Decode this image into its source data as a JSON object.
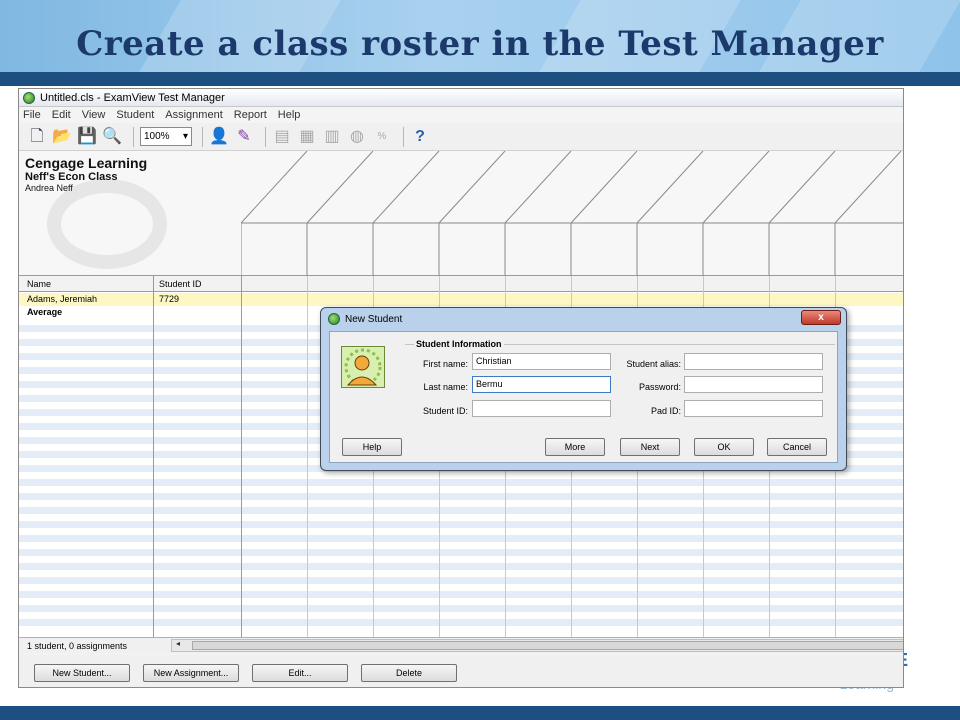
{
  "slide": {
    "title": "Create a class roster in the Test Manager",
    "brand_fragment": "E",
    "brand_fragment2": "Learning"
  },
  "window": {
    "title": "Untitled.cls - ExamView Test Manager",
    "menu": [
      "File",
      "Edit",
      "View",
      "Student",
      "Assignment",
      "Report",
      "Help"
    ],
    "zoom": "100%"
  },
  "class_info": {
    "organization": "Cengage Learning",
    "class_name": "Neff's Econ Class",
    "teacher": "Andrea Neff"
  },
  "grid": {
    "columns": [
      "Name",
      "Student ID"
    ],
    "rows": [
      {
        "name": "Adams, Jeremiah",
        "student_id": "7729"
      }
    ],
    "average_label": "Average"
  },
  "status": {
    "text": "1 student, 0 assignments"
  },
  "bottom_buttons": {
    "new_student": "New Student...",
    "new_assignment": "New Assignment...",
    "edit": "Edit...",
    "delete": "Delete"
  },
  "dialog": {
    "title": "New Student",
    "close": "x",
    "group_label": "Student Information",
    "first_name_label": "First name:",
    "first_name_value": "Christian",
    "last_name_label": "Last name:",
    "last_name_value": "Bermu",
    "student_id_label": "Student ID:",
    "student_id_value": "",
    "alias_label": "Student alias:",
    "alias_value": "",
    "password_label": "Password:",
    "password_value": "",
    "pad_id_label": "Pad ID:",
    "pad_id_value": "",
    "buttons": {
      "help": "Help",
      "more": "More",
      "next": "Next",
      "ok": "OK",
      "cancel": "Cancel"
    }
  },
  "colors": {
    "header_bar": "#1d4f80",
    "title_text": "#1b3a6b",
    "row_highlight": "#fdf7c3",
    "row_stripe": "#e3ecf7",
    "dialog_frame": "#b9d1ea"
  }
}
